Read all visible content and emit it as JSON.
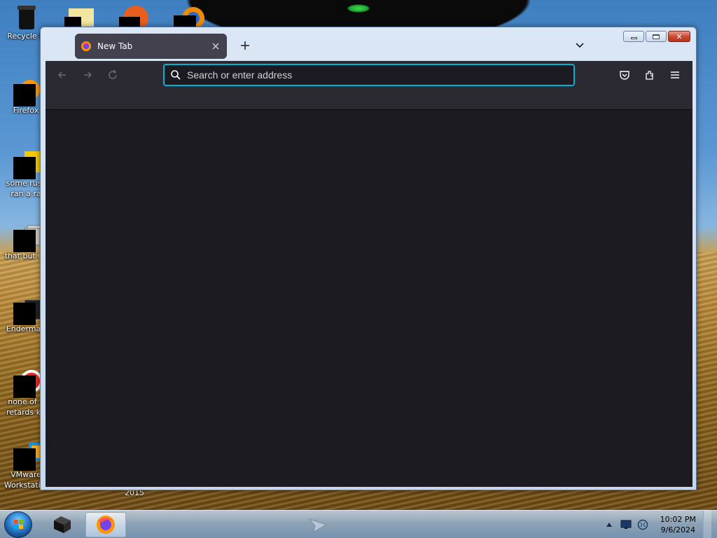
{
  "desktop": {
    "icons": [
      {
        "label": "Recycle B",
        "label2": ""
      },
      {
        "label": "Firefox",
        "label2": ""
      },
      {
        "label": "some russ",
        "label2": "ran a ra"
      },
      {
        "label": "that but its",
        "label2": ""
      },
      {
        "label": "Enderman",
        "label2": ""
      },
      {
        "label": "none of y",
        "label2": "retards kn"
      },
      {
        "label": "VMware",
        "label2": "Workstati..."
      }
    ],
    "year_label": "2015"
  },
  "browser": {
    "tab": {
      "title": "New Tab",
      "favicon": "firefox-icon",
      "close_icon": "close-icon"
    },
    "new_tab_icon": "plus-icon",
    "tab_list_icon": "chevron-down-icon",
    "address_bar": {
      "placeholder": "Search or enter address",
      "value": ""
    },
    "toolbar_icons": [
      "back-icon",
      "forward-icon",
      "reload-icon",
      "pocket-icon",
      "extensions-icon",
      "menu-icon"
    ],
    "window_controls": [
      "minimize",
      "maximize",
      "close"
    ]
  },
  "taskbar": {
    "clock_time": "10:02 PM",
    "clock_date": "9/6/2024",
    "items": [
      "start-orb",
      "terminal-app",
      "firefox-app"
    ]
  },
  "colors": {
    "browser_chrome": "#2b2a33",
    "content_bg": "#1c1b22",
    "url_focus": "#00b3d3",
    "tab_active": "#42414d"
  }
}
